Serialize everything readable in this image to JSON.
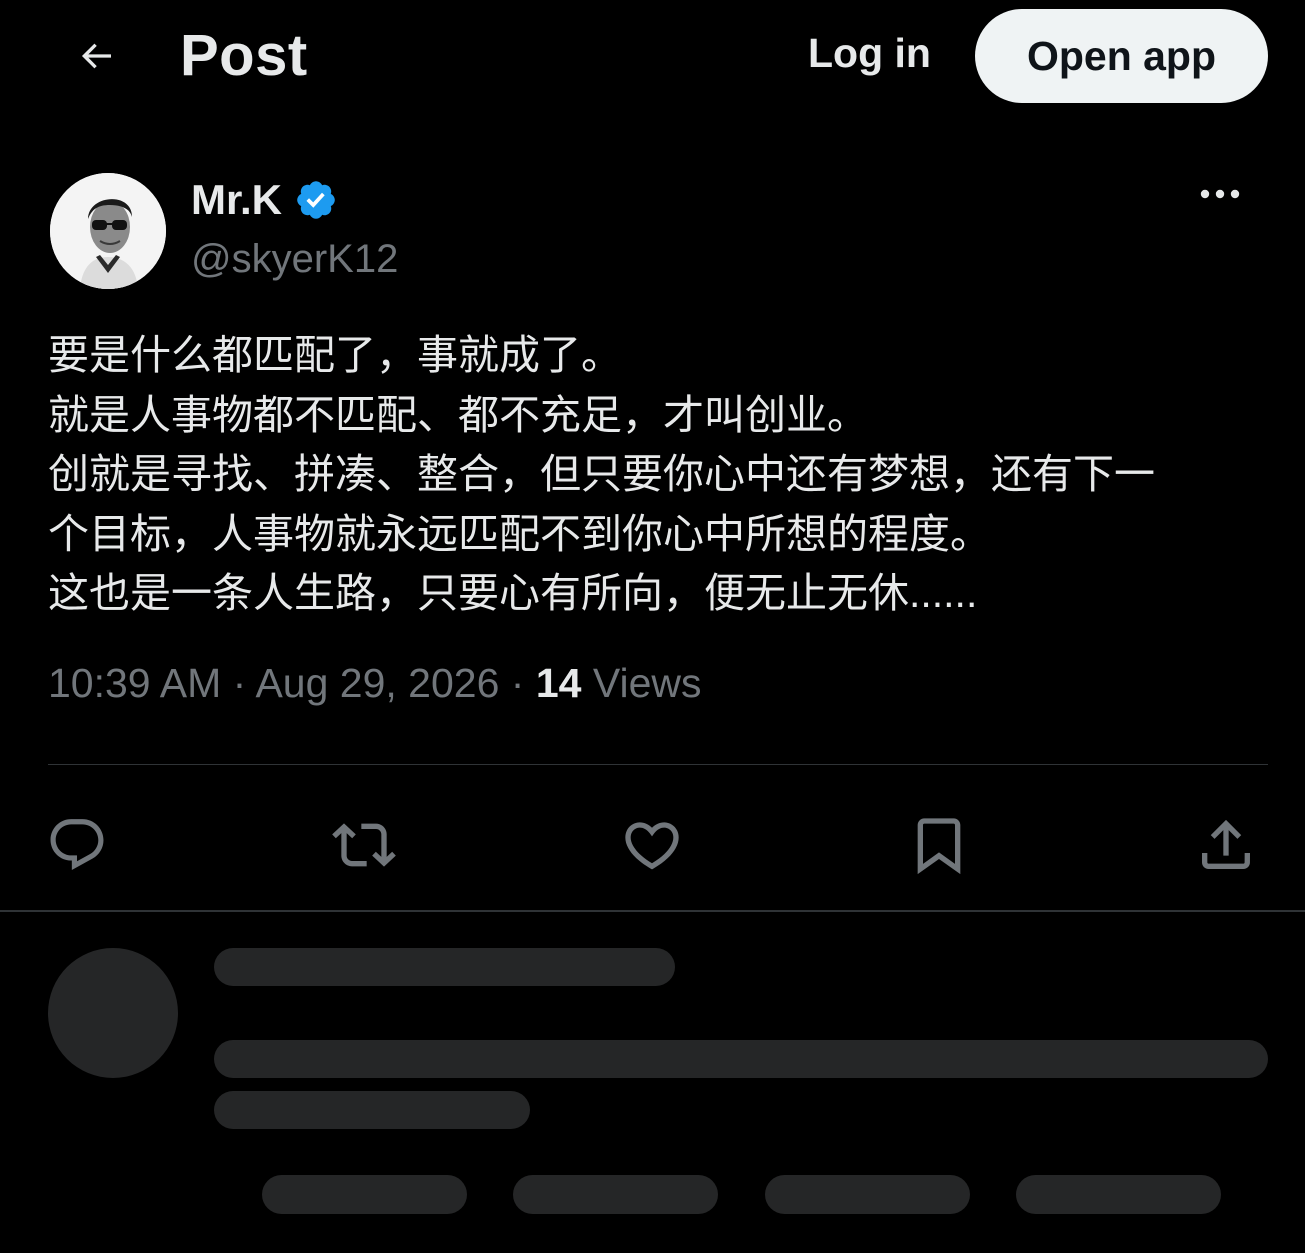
{
  "header": {
    "title": "Post",
    "login_label": "Log in",
    "open_app_label": "Open app"
  },
  "post": {
    "author_name": "Mr.K",
    "author_handle": "@skyerK12",
    "lines": [
      "要是什么都匹配了，事就成了。",
      "就是人事物都不匹配、都不充足，才叫创业。",
      "创就是寻找、拼凑、整合，但只要你心中还有梦想，还有下一",
      "个目标，人事物就永远匹配不到你心中所想的程度。",
      "这也是一条人生路，只要心有所向，便无止无休......"
    ],
    "time": "10:39 AM",
    "date": "Aug 29, 2026",
    "views_count": "14",
    "views_label": "Views"
  },
  "colors": {
    "background": "#000000",
    "text": "#e7e9ea",
    "muted": "#71767b",
    "verified": "#1d9bf0",
    "skeleton": "#252627"
  },
  "icons": [
    "back-arrow-icon",
    "verified-badge-icon",
    "more-icon",
    "reply-icon",
    "repost-icon",
    "like-icon",
    "bookmark-icon",
    "share-icon"
  ]
}
